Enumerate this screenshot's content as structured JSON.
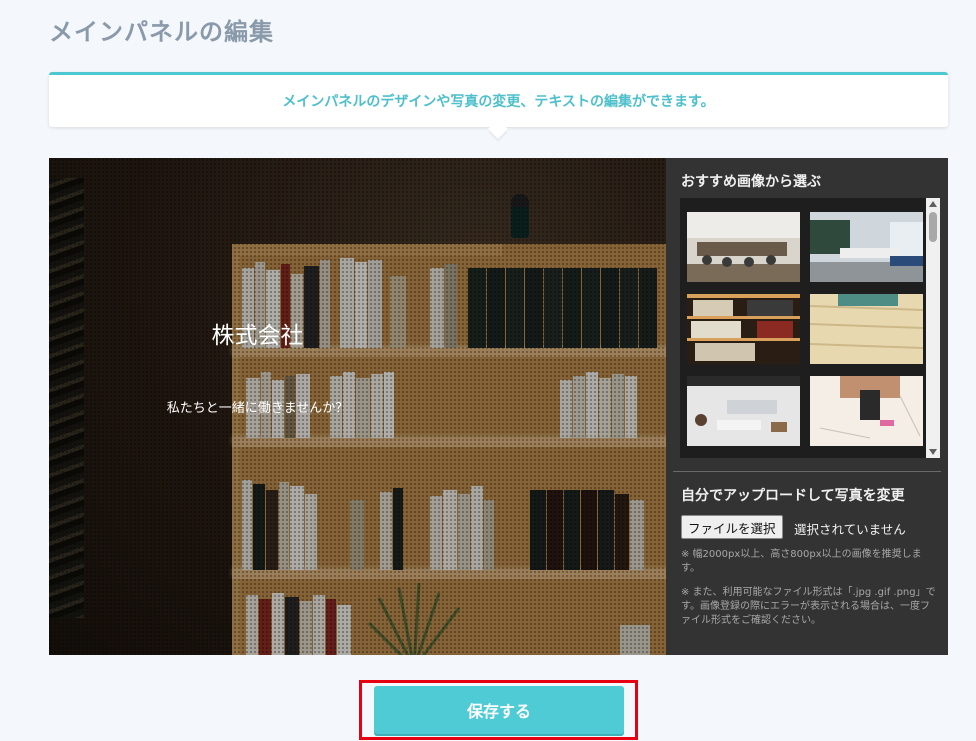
{
  "page": {
    "title": "メインパネルの編集",
    "info": "メインパネルのデザインや写真の変更、テキストの編集ができます。"
  },
  "preview": {
    "company_name": "株式会社",
    "tagline": "私たちと一緒に働きませんか？"
  },
  "side_panel": {
    "gallery_title": "おすすめ画像から選ぶ",
    "gallery_items": [
      {
        "name": "meeting-room-1"
      },
      {
        "name": "meeting-room-2"
      },
      {
        "name": "bookshelf"
      },
      {
        "name": "wood-typewriter"
      },
      {
        "name": "desk-keyboard"
      },
      {
        "name": "desk-smartphone"
      }
    ],
    "upload_title": "自分でアップロードして写真を変更",
    "file_button": "ファイルを選択",
    "file_status": "選択されていません",
    "note_size": "※ 幅2000px以上、高さ800px以上の画像を推奨します。",
    "note_format": "※ また、利用可能なファイル形式は「.jpg .gif .png」です。画像登録の際にエラーが表示される場合は、一度ファイル形式をご確認ください。"
  },
  "actions": {
    "save_label": "保存する"
  },
  "colors": {
    "accent": "#4ecbd5",
    "highlight_border": "#e60012",
    "panel_bg": "#333333"
  }
}
